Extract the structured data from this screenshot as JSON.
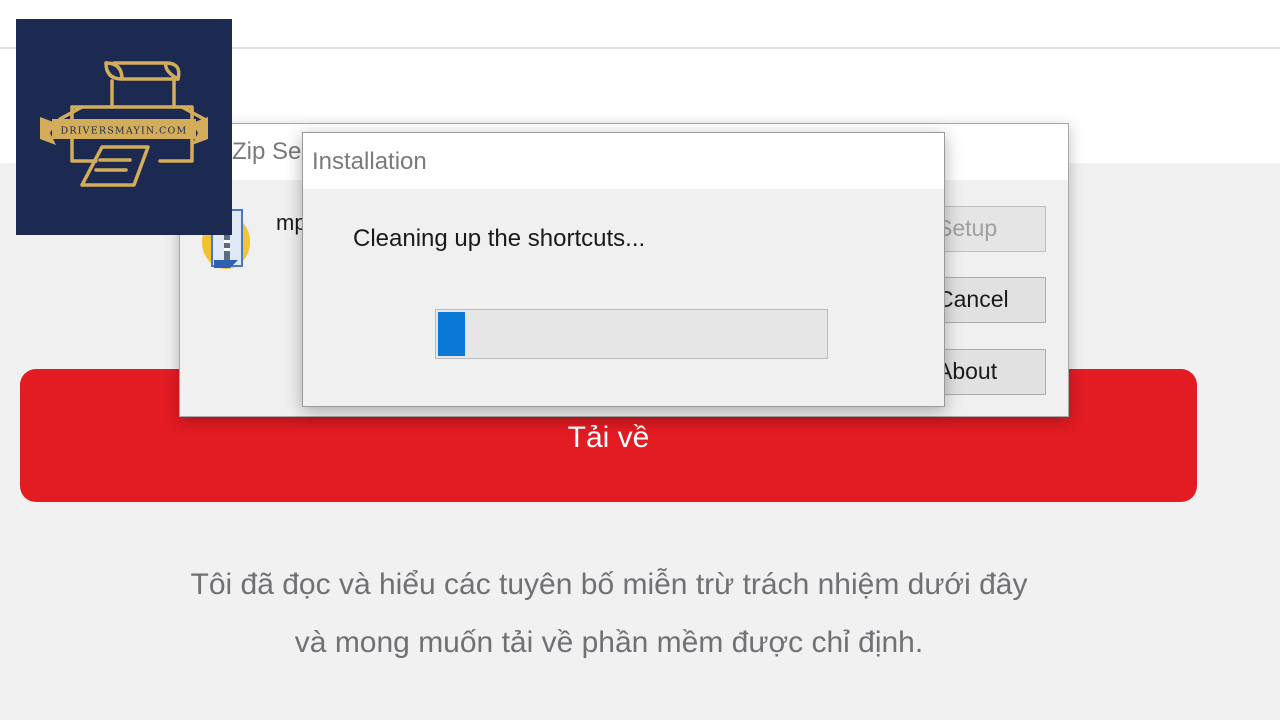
{
  "page": {
    "download_button_label": "Tải về",
    "disclaimer_line1": "Tôi đã đọc và hiểu các tuyên bố miễn trừ trách nhiệm dưới đây",
    "disclaimer_line2": "và mong muốn tải về phần mềm được chỉ định."
  },
  "logo": {
    "text": "DRIVERSMAYIN.COM"
  },
  "zip_dialog": {
    "title_partial": "Zip Se",
    "file_name_partial": "mp",
    "buttons": {
      "setup": "Setup",
      "cancel": "Cancel",
      "about": "About"
    }
  },
  "install_dialog": {
    "title": "Installation",
    "status": "Cleaning up the shortcuts...",
    "progress": 0.07
  },
  "colors": {
    "brand_red": "#e31b23",
    "logo_navy": "#1c2a52",
    "logo_gold": "#d4ad5a",
    "progress_blue": "#0a78d7"
  },
  "icons": [
    "winzip-icon",
    "printer-logo-icon"
  ]
}
